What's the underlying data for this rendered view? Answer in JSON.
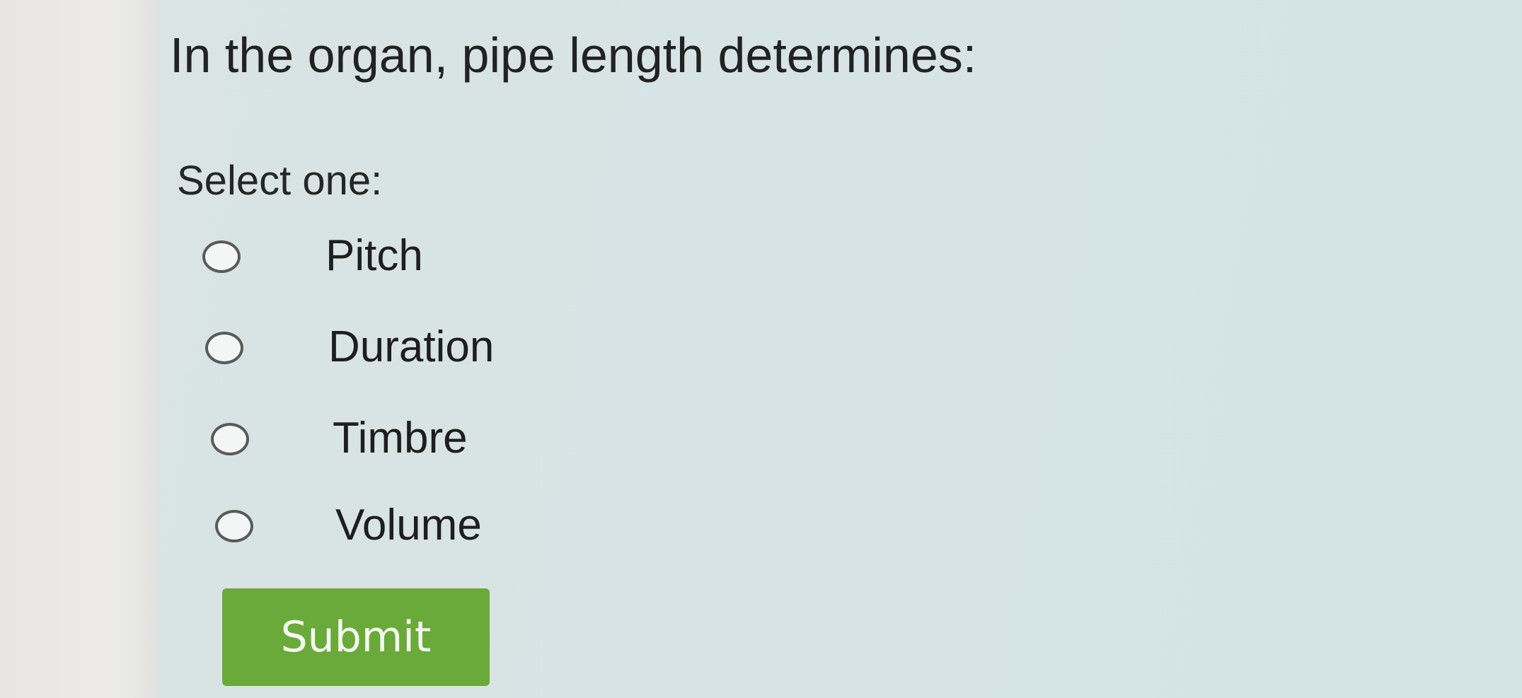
{
  "question": {
    "text": "In the organ, pipe length determines:"
  },
  "prompt": "Select one:",
  "options": [
    {
      "label": "Pitch",
      "selected": false
    },
    {
      "label": "Duration",
      "selected": false
    },
    {
      "label": "Timbre",
      "selected": false
    },
    {
      "label": "Volume",
      "selected": false
    }
  ],
  "submit": {
    "label": "Submit",
    "color": "#6aaa3a"
  }
}
